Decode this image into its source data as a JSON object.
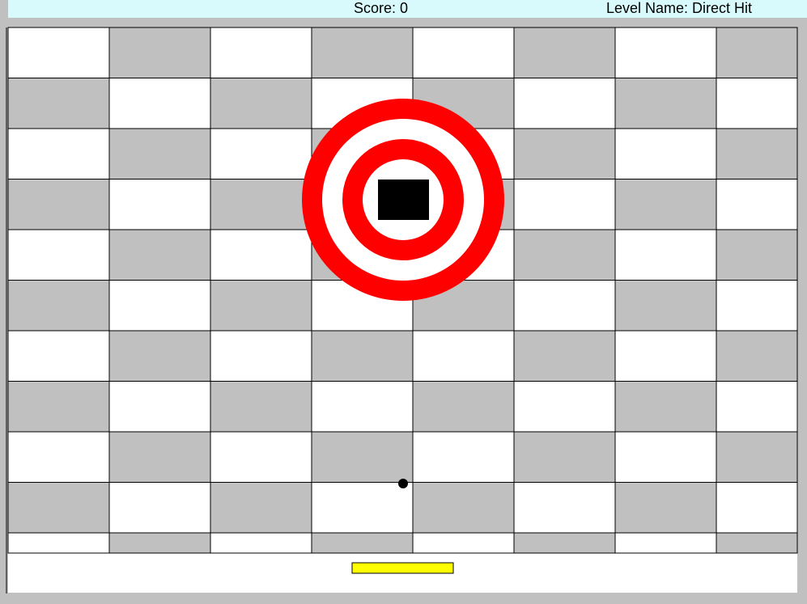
{
  "hud": {
    "score_label": "Score: 0",
    "level_label": "Level Name: Direct Hit"
  },
  "board": {
    "columns": 8,
    "rows": 11,
    "tile_colors": {
      "light": "#ffffff",
      "dark": "#c0c0c0"
    },
    "grid_line_color": "#000000"
  },
  "target": {
    "ring_color": "#ff0000",
    "gap_color": "#ffffff",
    "center_color": "#000000"
  },
  "ball": {
    "color": "#000000"
  },
  "paddle": {
    "color": "#ffff00",
    "outline": "#000000"
  }
}
